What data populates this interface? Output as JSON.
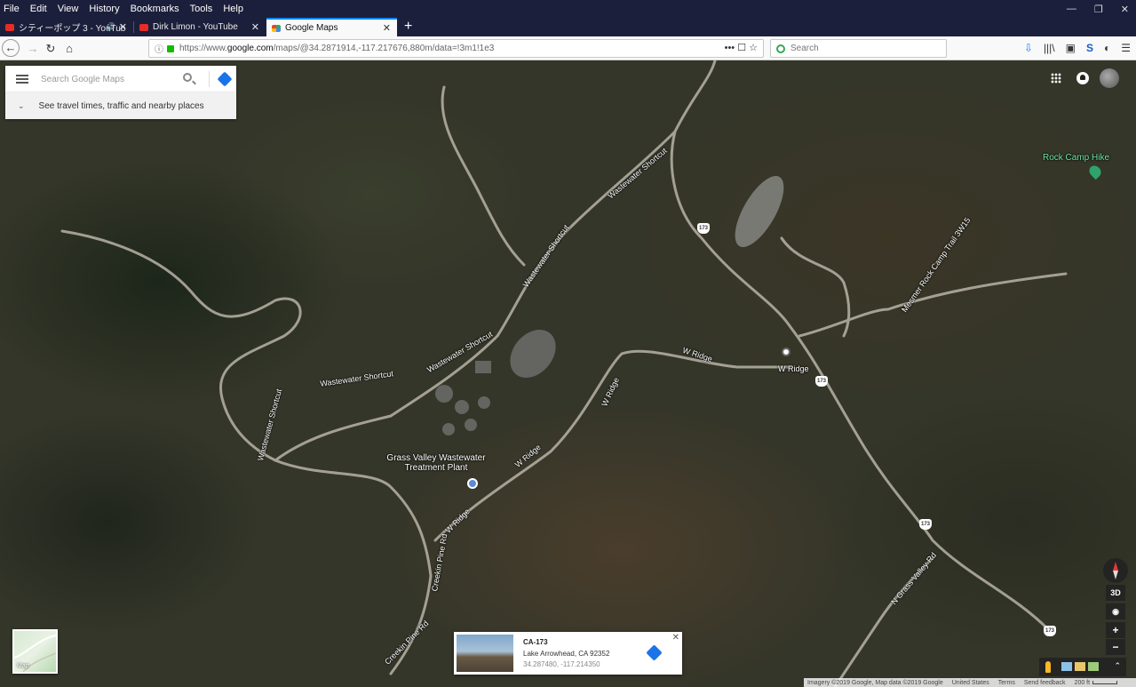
{
  "menu": [
    "File",
    "Edit",
    "View",
    "History",
    "Bookmarks",
    "Tools",
    "Help"
  ],
  "window_controls": {
    "minimize": "—",
    "restore": "❐",
    "close": "✕"
  },
  "tabs": [
    {
      "title": "シティーポップ 3 - YouTub",
      "audio": "🔊",
      "close": "✕"
    },
    {
      "title": "Dirk Limon - YouTube",
      "close": "✕"
    },
    {
      "title": "Google Maps",
      "close": "✕"
    }
  ],
  "new_tab": "+",
  "nav": {
    "back": "←",
    "forward": "→",
    "reload": "↻",
    "home": "⌂"
  },
  "url": {
    "prefix": "https://www.",
    "host": "google.com",
    "path": "/maps/@34.2871914,-117.217676,880m/data=!3m1!1e3",
    "actions": "••• ☐ ☆"
  },
  "browser_search": {
    "placeholder": "Search"
  },
  "toolbar_icons": [
    "⇩",
    "|||\\",
    "▣",
    "S",
    "◐",
    "☰"
  ],
  "maps": {
    "search_placeholder": "Search Google Maps",
    "travel_chevron": "⌄",
    "travel_text": "See travel times, traffic and nearby places"
  },
  "map_labels": {
    "rock_camp_hike": "Rock Camp Hike",
    "wastewater_shortcut_1": "Wastewater Shortcut",
    "wastewater_shortcut_2": "Wastewater Shortcut",
    "wastewater_shortcut_3": "Wastewater Shortcut",
    "wastewater_shortcut_4": "Wastewater Shortcut",
    "wastewater_shortcut_5": "Wastewater Shortcut",
    "w_ridge_1": "W Ridge",
    "w_ridge_2": "W Ridge",
    "w_ridge_3": "W Ridge",
    "w_ridge_4": "W Ridge",
    "w_ridge_5": "W Ridge",
    "grass_valley_plant": "Grass Valley Wastewater Treatment Plant",
    "creekin_pine_1": "Creekin Pine Rd",
    "creekin_pine_2": "Creekin Pine Rd",
    "n_grass_valley": "N Grass Valley Rd",
    "mesmer_rock": "Mesmer Rock Camp Trail 3W15",
    "route_173": "173"
  },
  "controls": {
    "tilt": "3D",
    "locate": "◉",
    "zoom_in": "+",
    "zoom_out": "−",
    "expand": "⌃"
  },
  "info_card": {
    "title": "CA-173",
    "subtitle": "Lake Arrowhead, CA 92352",
    "coords": "34.287480, -117.214350",
    "close": "✕"
  },
  "map_type": {
    "label": "Map"
  },
  "footer": {
    "imagery": "Imagery ©2019 Google, Map data ©2019 Google",
    "country": "United States",
    "terms": "Terms",
    "feedback": "Send feedback",
    "scale": "200 ft"
  },
  "colors": {
    "browser_chrome": "#1c1f3b",
    "accent": "#0a84ff",
    "maps_blue": "#1a73e8",
    "poi_green": "#34d399"
  }
}
